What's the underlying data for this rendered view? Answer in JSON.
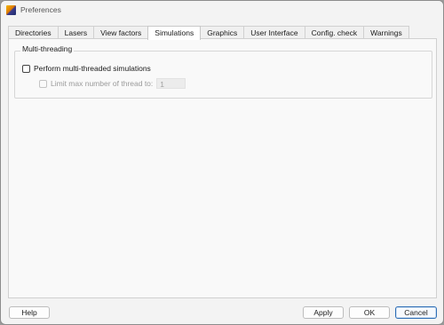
{
  "window": {
    "title": "Preferences"
  },
  "tabs": [
    {
      "label": "Directories"
    },
    {
      "label": "Lasers"
    },
    {
      "label": "View factors"
    },
    {
      "label": "Simulations"
    },
    {
      "label": "Graphics"
    },
    {
      "label": "User Interface"
    },
    {
      "label": "Config. check"
    },
    {
      "label": "Warnings"
    }
  ],
  "active_tab": "Simulations",
  "simulations": {
    "group_title": "Multi-threading",
    "perform_multithreaded_label": "Perform multi-threaded simulations",
    "perform_multithreaded_checked": false,
    "limit_threads_label": "Limit max number of thread to:",
    "limit_threads_checked": false,
    "max_threads_value": "1"
  },
  "buttons": {
    "help": "Help",
    "apply": "Apply",
    "ok": "OK",
    "cancel": "Cancel"
  }
}
